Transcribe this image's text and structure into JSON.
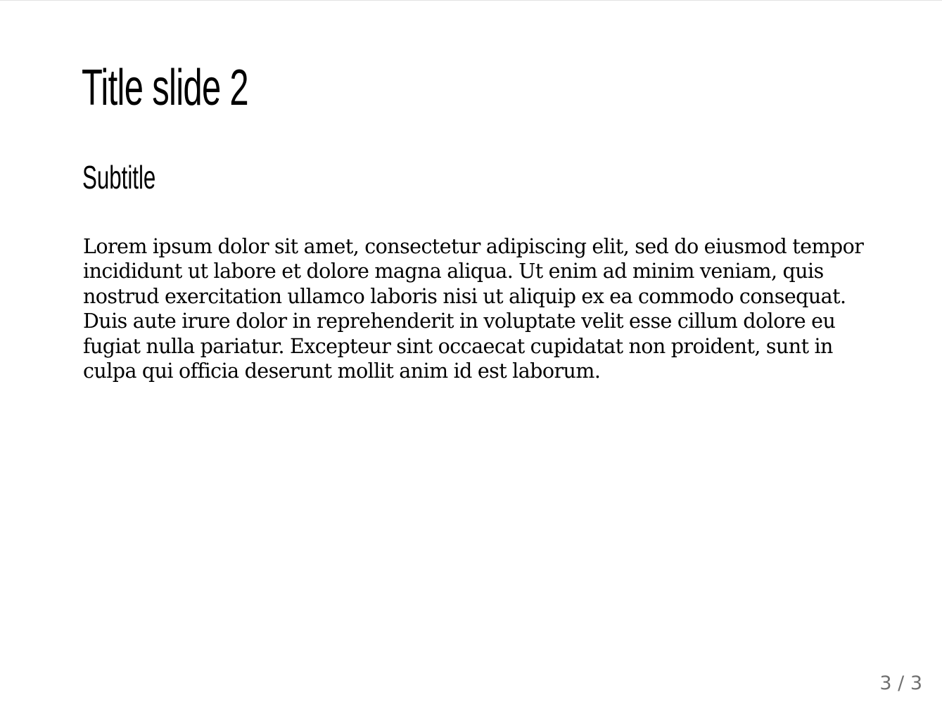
{
  "slide": {
    "title": "Title slide 2",
    "subtitle": "Subtitle",
    "body": "Lorem ipsum dolor sit amet, consectetur adipiscing elit, sed do eiusmod tempor incididunt ut labore et dolore magna aliqua. Ut enim ad minim veniam, quis nostrud exercitation ullamco laboris nisi ut aliquip ex ea commodo consequat. Duis aute irure dolor in reprehenderit in voluptate velit esse cillum dolore eu fugiat nulla pariatur. Excepteur sint occaecat cupidatat non proident, sunt in culpa qui officia deserunt mollit anim id est laborum."
  },
  "pager": {
    "label": "3 / 3",
    "current": 3,
    "total": 3
  },
  "colors": {
    "background": "#ffffff",
    "text": "#000000",
    "page_number": "#707070"
  }
}
